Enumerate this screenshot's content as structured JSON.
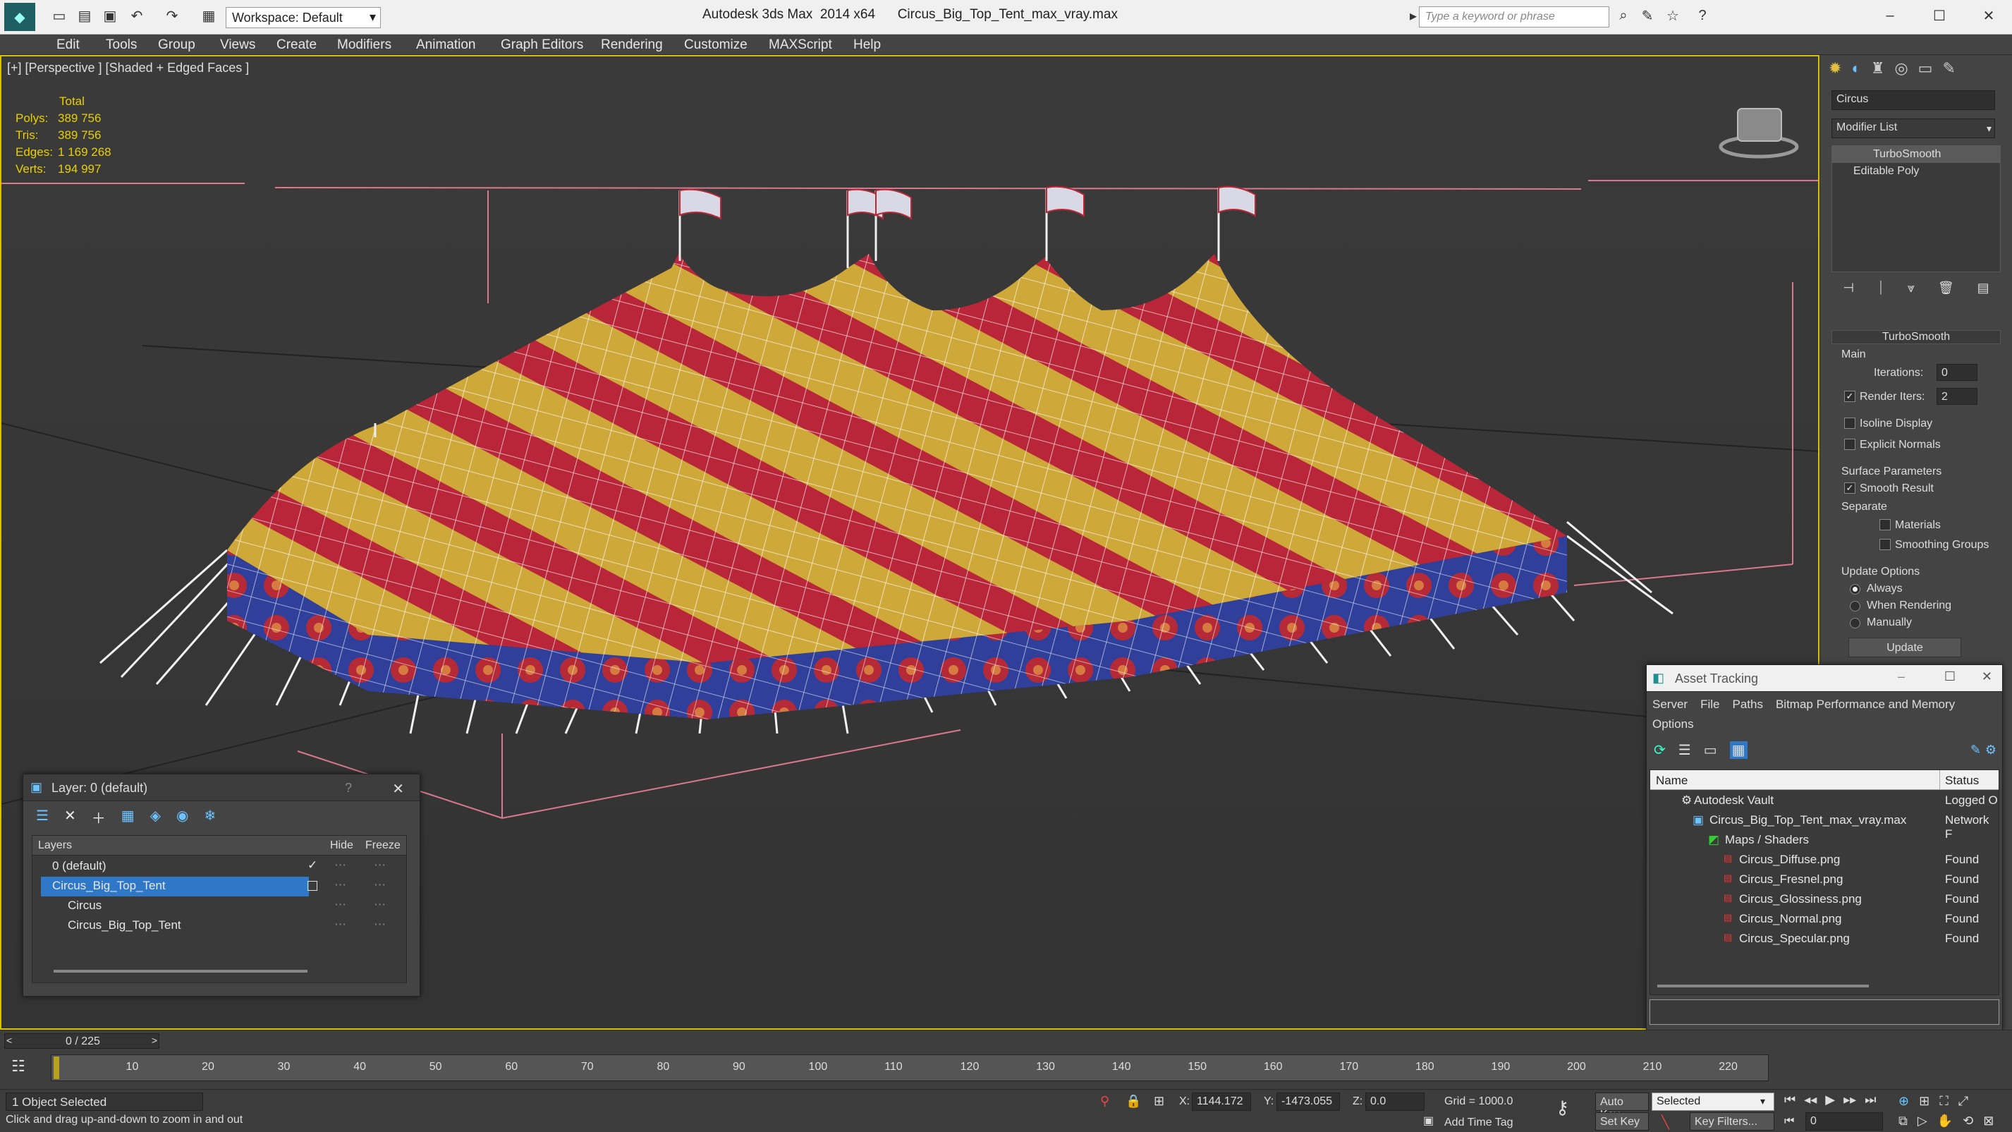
{
  "app": {
    "title": "Autodesk 3ds Max  2014 x64      Circus_Big_Top_Tent_max_vray.max",
    "workspace": "Workspace: Default",
    "search_placeholder": "Type a keyword or phrase"
  },
  "menu": [
    "Edit",
    "Tools",
    "Group",
    "Views",
    "Create",
    "Modifiers",
    "Animation",
    "Graph Editors",
    "Rendering",
    "Customize",
    "MAXScript",
    "Help"
  ],
  "viewport": {
    "label": "[+] [Perspective ] [Shaded + Edged Faces ]",
    "stats": {
      "header": "Total",
      "polys_label": "Polys:",
      "polys": "389 756",
      "tris_label": "Tris:",
      "tris": "389 756",
      "edges_label": "Edges:",
      "edges": "1 169 268",
      "verts_label": "Verts:",
      "verts": "194 997"
    }
  },
  "command_panel": {
    "object_name": "Circus",
    "modifier_list": "Modifier List",
    "stack": [
      "TurboSmooth",
      "Editable Poly"
    ],
    "rollout_title": "TurboSmooth",
    "main_label": "Main",
    "iterations_label": "Iterations:",
    "iterations": "0",
    "render_iters_label": "Render Iters:",
    "render_iters": "2",
    "isoline": "Isoline Display",
    "explicit_normals": "Explicit Normals",
    "surface_params": "Surface Parameters",
    "smooth_result": "Smooth Result",
    "separate": "Separate",
    "materials": "Materials",
    "smoothing_groups": "Smoothing Groups",
    "update_options": "Update Options",
    "always": "Always",
    "when_rendering": "When Rendering",
    "manually": "Manually",
    "update_button": "Update"
  },
  "layer_panel": {
    "title": "Layer: 0 (default)",
    "help": "?",
    "col_layers": "Layers",
    "col_hide": "Hide",
    "col_freeze": "Freeze",
    "rows": [
      "0 (default)",
      "Circus_Big_Top_Tent",
      "Circus",
      "Circus_Big_Top_Tent"
    ]
  },
  "asset_panel": {
    "title": "Asset Tracking",
    "menu": [
      "Server",
      "File",
      "Paths",
      "Bitmap Performance and Memory"
    ],
    "menu2": "Options",
    "col_name": "Name",
    "col_status": "Status",
    "rows": [
      {
        "name": "Autodesk Vault",
        "status": "Logged O"
      },
      {
        "name": "Circus_Big_Top_Tent_max_vray.max",
        "status": "Network F"
      },
      {
        "name": "Maps / Shaders",
        "status": ""
      },
      {
        "name": "Circus_Diffuse.png",
        "status": "Found"
      },
      {
        "name": "Circus_Fresnel.png",
        "status": "Found"
      },
      {
        "name": "Circus_Glossiness.png",
        "status": "Found"
      },
      {
        "name": "Circus_Normal.png",
        "status": "Found"
      },
      {
        "name": "Circus_Specular.png",
        "status": "Found"
      }
    ]
  },
  "timeline": {
    "frame_counter": "0 / 225",
    "ticks": [
      "10",
      "20",
      "30",
      "40",
      "50",
      "60",
      "70",
      "80",
      "90",
      "100",
      "110",
      "120",
      "130",
      "140",
      "150",
      "160",
      "170",
      "180",
      "190",
      "200",
      "210",
      "220"
    ]
  },
  "status": {
    "selected": "1 Object Selected",
    "hint": "Click and drag up-and-down to zoom in and out",
    "x_label": "X:",
    "x": "1144.172",
    "y_label": "Y:",
    "y": "-1473.055",
    "z_label": "Z:",
    "z": "0.0",
    "grid": "Grid = 1000.0",
    "auto_key": "Auto Key",
    "set_key": "Set Key",
    "selected_dropdown": "Selected",
    "key_filters": "Key Filters...",
    "add_time_tag": "Add Time Tag",
    "frame": "0"
  }
}
